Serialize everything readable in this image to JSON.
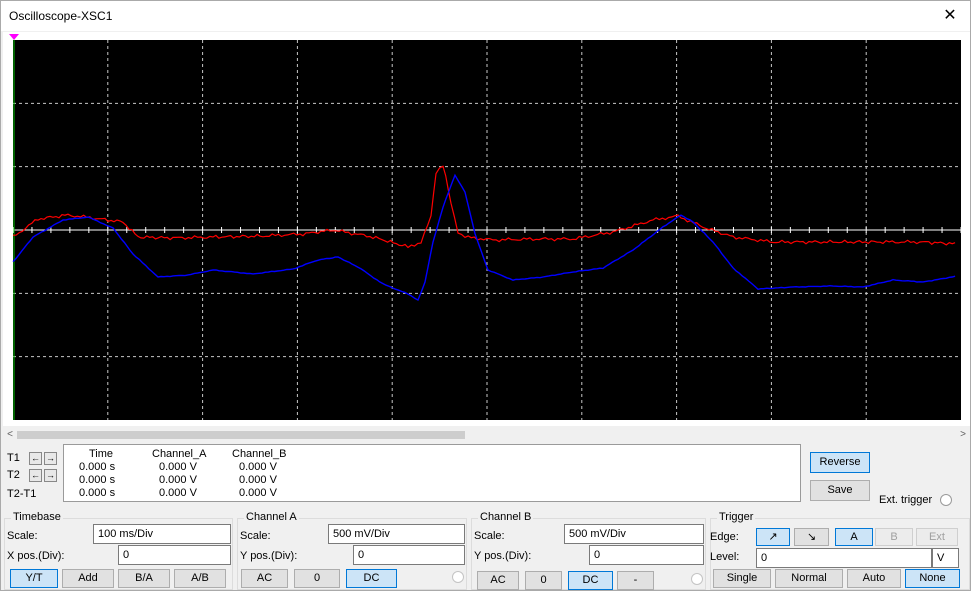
{
  "window": {
    "title": "Oscilloscope-XSC1",
    "close_glyph": "✕"
  },
  "screen": {
    "background": "#000000",
    "grid_color": "#c8c8c8",
    "channel_a_color": "#ff0000",
    "channel_b_color": "#0000ff",
    "cursor_t1_color": "#ff00ff",
    "cursor_t2_color": "#00c000"
  },
  "scrollbar": {
    "left_arrow": "<",
    "right_arrow": ">"
  },
  "cursors": {
    "t1_label": "T1",
    "t2_label": "T2",
    "t2t1_label": "T2-T1",
    "left_arrow_glyph": "←",
    "right_arrow_glyph": "→"
  },
  "readout": {
    "headers": [
      "Time",
      "Channel_A",
      "Channel_B"
    ],
    "rows": [
      [
        "0.000 s",
        "0.000 V",
        "0.000 V"
      ],
      [
        "0.000 s",
        "0.000 V",
        "0.000 V"
      ],
      [
        "0.000 s",
        "0.000 V",
        "0.000 V"
      ]
    ]
  },
  "actions": {
    "reverse": "Reverse",
    "save": "Save",
    "ext_trigger": "Ext. trigger"
  },
  "timebase": {
    "title": "Timebase",
    "scale_label": "Scale:",
    "scale_value": "100 ms/Div",
    "xpos_label": "X pos.(Div):",
    "xpos_value": "0",
    "modes": [
      "Y/T",
      "Add",
      "B/A",
      "A/B"
    ],
    "active_mode": "Y/T"
  },
  "channel_a": {
    "title": "Channel A",
    "scale_label": "Scale:",
    "scale_value": "500 mV/Div",
    "ypos_label": "Y pos.(Div):",
    "ypos_value": "0",
    "coupling": [
      "AC",
      "0",
      "DC"
    ],
    "active_coupling": "DC"
  },
  "channel_b": {
    "title": "Channel B",
    "scale_label": "Scale:",
    "scale_value": "500 mV/Div",
    "ypos_label": "Y pos.(Div):",
    "ypos_value": "0",
    "coupling": [
      "AC",
      "0",
      "DC",
      "-"
    ],
    "active_coupling": "DC"
  },
  "trigger": {
    "title": "Trigger",
    "edge_label": "Edge:",
    "level_label": "Level:",
    "level_value": "0",
    "level_unit": "V",
    "edge_rising_glyph": "↗",
    "edge_falling_glyph": "↘",
    "sources": [
      "A",
      "B",
      "Ext"
    ],
    "active_source": "A",
    "modes": [
      "Single",
      "Normal",
      "Auto",
      "None"
    ],
    "active_mode": "None"
  }
}
